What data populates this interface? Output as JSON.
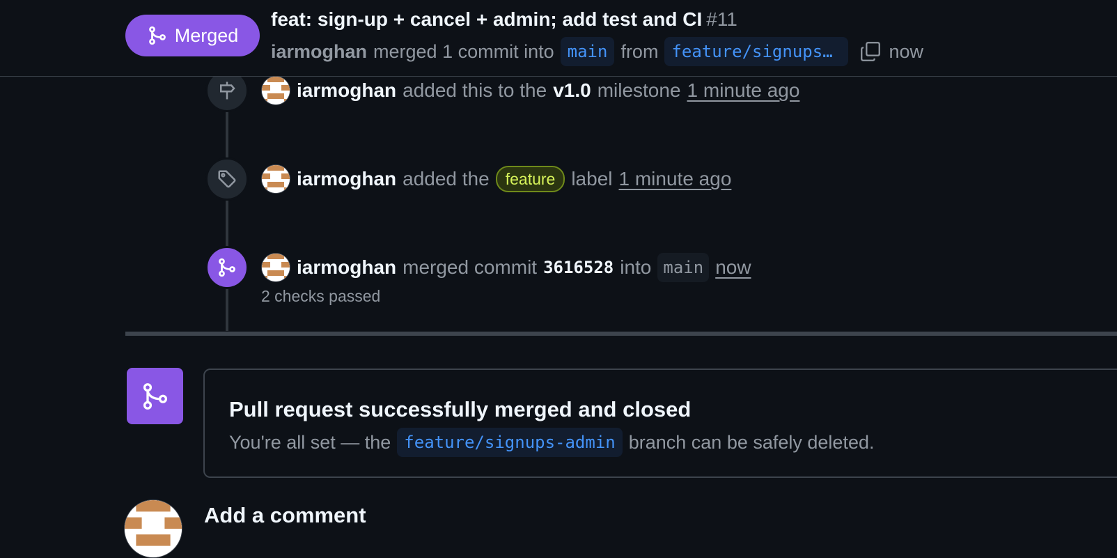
{
  "header": {
    "status_label": "Merged",
    "title": "feat: sign-up + cancel + admin; add test and CI",
    "number": "#11",
    "author": "iarmoghan",
    "merged_text": "merged 1 commit into",
    "base_branch": "main",
    "from_text": "from",
    "head_branch": "feature/signups-…",
    "time": "now"
  },
  "timeline": {
    "milestone_event": {
      "actor": "iarmoghan",
      "text_before": "added this to the",
      "milestone": "v1.0",
      "text_after": "milestone",
      "time": "1 minute ago"
    },
    "label_event": {
      "actor": "iarmoghan",
      "text_before": "added the",
      "label": "feature",
      "text_after": "label",
      "time": "1 minute ago"
    },
    "merge_event": {
      "actor": "iarmoghan",
      "text_before": "merged commit",
      "sha": "3616528",
      "into_text": "into",
      "branch": "main",
      "time": "now",
      "checks": "2 checks passed"
    }
  },
  "merge_box": {
    "title": "Pull request successfully merged and closed",
    "sub_before": "You're all set — the",
    "branch": "feature/signups-admin",
    "sub_after": "branch can be safely deleted."
  },
  "comment": {
    "heading": "Add a comment"
  },
  "colors": {
    "merged_purple": "#8957e5",
    "background": "#0d1117",
    "link_blue": "#4493f8",
    "label_green": "#d7f35a"
  }
}
